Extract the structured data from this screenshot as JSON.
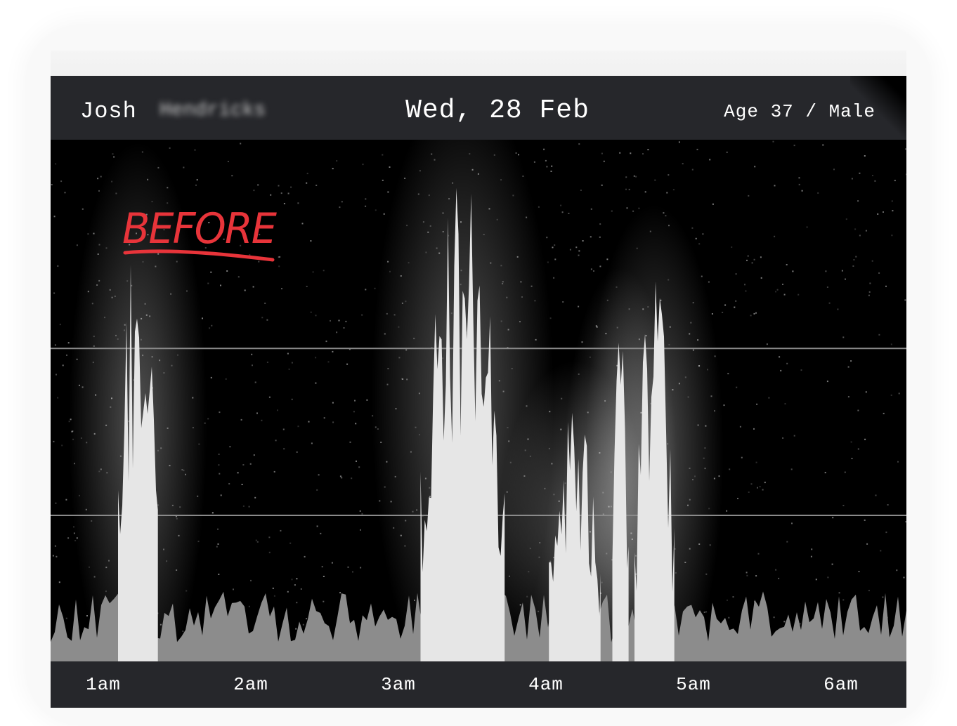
{
  "header": {
    "first_name": "Josh",
    "last_name_redacted": "Hendricks",
    "date": "Wed, 28 Feb",
    "demographics": "Age 37 / Male"
  },
  "annotation": {
    "label": "BEFORE",
    "color": "#e8343a"
  },
  "chart_data": {
    "type": "area",
    "x_unit": "time of night",
    "x_ticks": [
      "1am",
      "2am",
      "3am",
      "4am",
      "5am",
      "6am"
    ],
    "xlim": [
      0.6,
      6.4
    ],
    "ylim": [
      0,
      1
    ],
    "grid": "two horizontal lines",
    "colors": {
      "background": "#000000",
      "baseline": "#8c8c8c",
      "peaks": "#e6e6e6"
    },
    "baseline_level": 0.09,
    "peaks": [
      {
        "start": 1.1,
        "end": 1.37,
        "max": 0.83
      },
      {
        "start": 3.15,
        "end": 3.72,
        "max": 0.92
      },
      {
        "start": 4.02,
        "end": 4.37,
        "max": 0.48
      },
      {
        "start": 4.45,
        "end": 4.56,
        "max": 0.63
      },
      {
        "start": 4.6,
        "end": 4.87,
        "max": 0.73
      }
    ]
  }
}
